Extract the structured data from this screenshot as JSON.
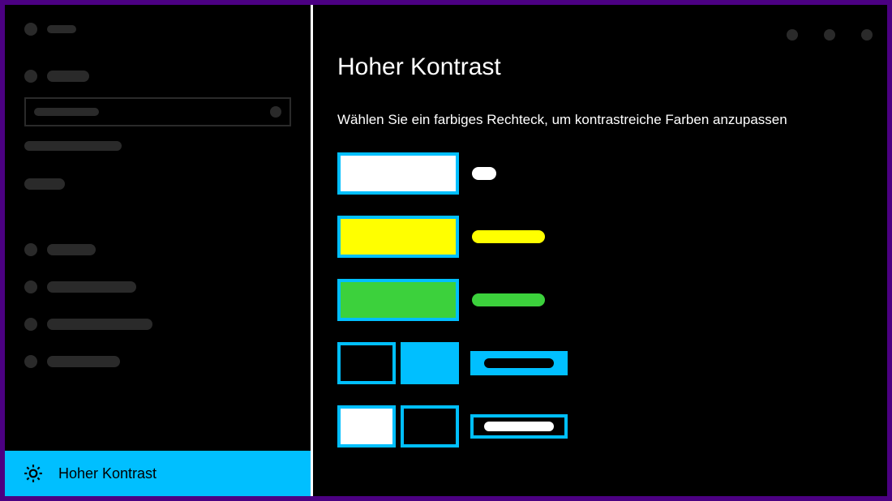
{
  "header": {
    "title": "Hoher Kontrast",
    "subtitle": "Wählen Sie ein farbiges Rechteck, um kontrastreiche Farben anzupassen"
  },
  "sidebar": {
    "selected_label": "Hoher Kontrast"
  },
  "colors": {
    "accent": "#00bfff",
    "swatches": [
      {
        "kind": "single",
        "fill": "#ffffff",
        "pill_fill": "#ffffff",
        "pill_width": 30
      },
      {
        "kind": "single",
        "fill": "#ffff00",
        "pill_fill": "#ffff00",
        "pill_width": 90
      },
      {
        "kind": "single",
        "fill": "#3cd13c",
        "pill_fill": "#3cd13c",
        "pill_width": 90
      },
      {
        "kind": "pair",
        "left": "#000000",
        "right": "#00bfff",
        "boxed": true,
        "box_fill": "#00bfff",
        "inner_pill": "#000000"
      },
      {
        "kind": "pair",
        "left": "#ffffff",
        "right": "#000000",
        "boxed": true,
        "box_fill": "#000000",
        "inner_pill": "#ffffff"
      }
    ]
  }
}
